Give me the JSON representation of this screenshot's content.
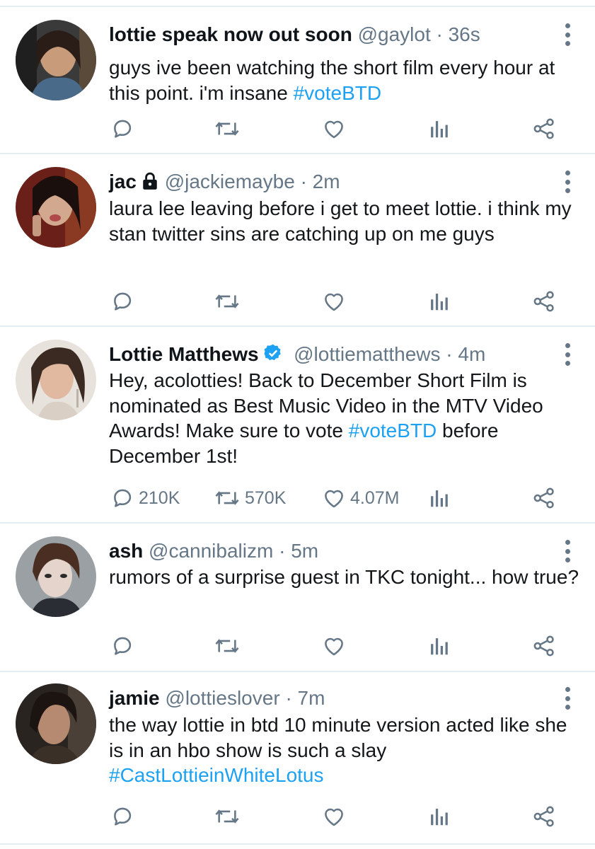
{
  "colors": {
    "accent": "#1da1f2",
    "muted": "#657786",
    "divider": "#e6ecf0"
  },
  "icons": {
    "reply": "reply-icon",
    "retweet": "retweet-icon",
    "like": "heart-icon",
    "stats": "analytics-icon",
    "share": "share-icon",
    "more": "more-vertical-icon",
    "lock": "lock-icon",
    "verified": "verified-badge-icon"
  },
  "tweets": [
    {
      "name": "lottie speak now out soon",
      "handle": "@gaylot",
      "time": "· 36s",
      "text": "guys ive been watching the short film every hour at this point. i'm insane ",
      "hashtag": "#voteBTD",
      "text_after": "",
      "counts": {
        "reply": "",
        "retweet": "",
        "like": ""
      }
    },
    {
      "name": "jac",
      "handle": "@jackiemaybe",
      "time": "· 2m",
      "protected": true,
      "text": "laura lee leaving before i get to meet lottie. i think my stan twitter sins are catching up on me guys",
      "hashtag": "",
      "text_after": "",
      "counts": {
        "reply": "",
        "retweet": "",
        "like": ""
      }
    },
    {
      "name": "Lottie Matthews",
      "handle": "@lottiematthews",
      "time": "· 4m",
      "verified": true,
      "text": "Hey, acolotties! Back to December Short Film is nominated as Best Music Video in the MTV Video Awards! Make sure to vote ",
      "hashtag": "#voteBTD",
      "text_after": " before December 1st!",
      "counts": {
        "reply": "210K",
        "retweet": "570K",
        "like": "4.07M"
      }
    },
    {
      "name": "ash",
      "handle": "@cannibalizm",
      "time": "· 5m",
      "text": "rumors of a surprise guest in TKC tonight... how true?",
      "hashtag": "",
      "text_after": "",
      "counts": {
        "reply": "",
        "retweet": "",
        "like": ""
      }
    },
    {
      "name": "jamie",
      "handle": "@lottieslover",
      "time": "· 7m",
      "text": "the way lottie in btd 10 minute version acted like she is in an hbo show is such a slay ",
      "hashtag": "#CastLottieinWhiteLotus",
      "text_after": "",
      "counts": {
        "reply": "",
        "retweet": "",
        "like": ""
      }
    }
  ]
}
